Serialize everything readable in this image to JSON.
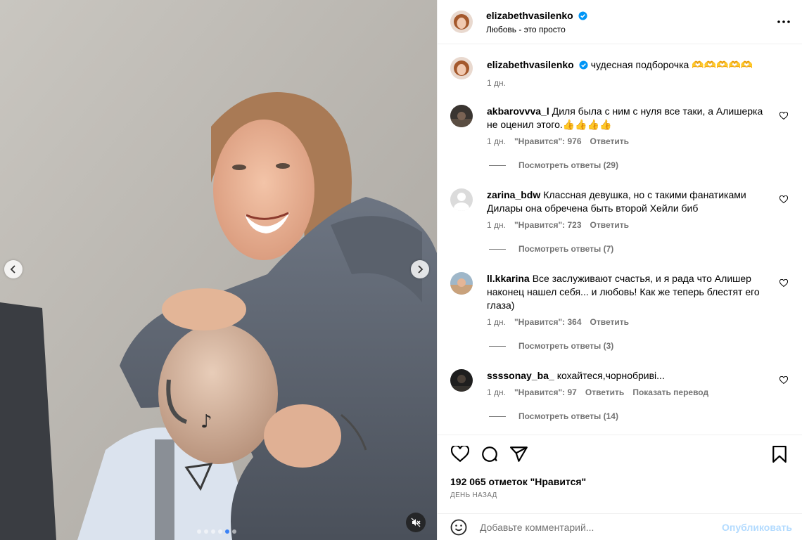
{
  "post": {
    "author": "elizabethvasilenko",
    "location": "Любовь - это просто"
  },
  "caption": {
    "username": "elizabethvasilenko",
    "text": "чудесная подборочка 🫶🫶🫶🫶🫶",
    "time": "1 дн."
  },
  "comments": [
    {
      "username": "akbarovvva_l",
      "text": "Диля была с ним с нуля все таки, а Алишерка не оценил этого.👍👍👍👍",
      "time": "1 дн.",
      "likes": "\"Нравится\": 976",
      "reply": "Ответить",
      "view_replies": "Посмотреть ответы (29)"
    },
    {
      "username": "zarina_bdw",
      "text": "Классная девушка, но с такими фанатиками Дилары она обречена быть второй Хейли биб",
      "time": "1 дн.",
      "likes": "\"Нравится\": 723",
      "reply": "Ответить",
      "view_replies": "Посмотреть ответы (7)"
    },
    {
      "username": "ll.kkarina",
      "text": "Все заслуживают счастья, и я рада что Алишер наконец нашел себя... и любовь! Как же теперь блестят его глаза)",
      "time": "1 дн.",
      "likes": "\"Нравится\": 364",
      "reply": "Ответить",
      "view_replies": "Посмотреть ответы (3)"
    },
    {
      "username": "ssssonay_ba_",
      "text": "кохайтеся,чорнобриві...",
      "time": "1 дн.",
      "likes": "\"Нравится\": 97",
      "reply": "Ответить",
      "translate": "Показать перевод",
      "view_replies": "Посмотреть ответы (14)"
    }
  ],
  "stats": {
    "likes": "192 065 отметок \"Нравится\"",
    "date": "ДЕНЬ НАЗАД"
  },
  "composer": {
    "placeholder": "Добавьте комментарий...",
    "publish": "Опубликовать"
  },
  "carousel": {
    "slides": 6,
    "active_index": 4
  },
  "colors": {
    "verified": "#0095f6",
    "secondary_text": "#737373",
    "active_dot": "#3b82f6",
    "publish_disabled": "#b3dbff"
  },
  "icons": [
    "more-icon",
    "heart-icon",
    "comment-icon",
    "share-icon",
    "bookmark-icon",
    "emoji-icon",
    "chevron-left-icon",
    "chevron-right-icon",
    "muted-speaker-icon",
    "verified-badge-icon"
  ]
}
